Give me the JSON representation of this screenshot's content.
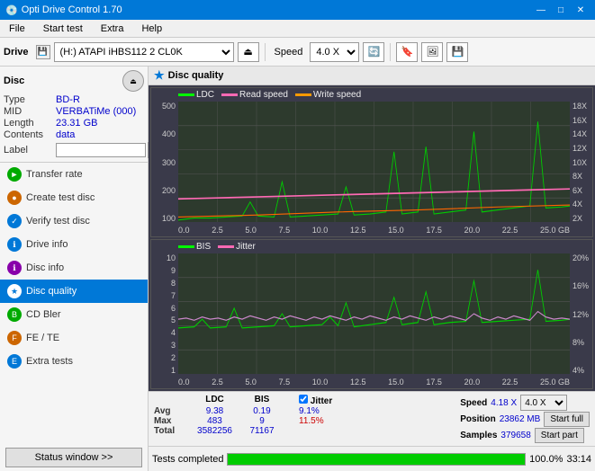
{
  "app": {
    "title": "Opti Drive Control 1.70",
    "icon": "💿"
  },
  "titlebar": {
    "title": "Opti Drive Control 1.70",
    "minimize": "—",
    "maximize": "□",
    "close": "✕"
  },
  "menubar": {
    "items": [
      "File",
      "Start test",
      "Extra",
      "Help"
    ]
  },
  "toolbar": {
    "drive_label": "Drive",
    "drive_value": "(H:)  ATAPI iHBS112  2 CL0K",
    "speed_label": "Speed",
    "speed_value": "4.0 X"
  },
  "disc": {
    "header": "Disc",
    "type_label": "Type",
    "type_value": "BD-R",
    "mid_label": "MID",
    "mid_value": "VERBATiMe (000)",
    "length_label": "Length",
    "length_value": "23.31 GB",
    "contents_label": "Contents",
    "contents_value": "data",
    "label_label": "Label",
    "label_placeholder": ""
  },
  "sidebar_items": [
    {
      "id": "transfer-rate",
      "label": "Transfer rate",
      "icon": "►",
      "active": false
    },
    {
      "id": "create-test-disc",
      "label": "Create test disc",
      "icon": "●",
      "active": false
    },
    {
      "id": "verify-test-disc",
      "label": "Verify test disc",
      "icon": "✓",
      "active": false
    },
    {
      "id": "drive-info",
      "label": "Drive info",
      "icon": "ℹ",
      "active": false
    },
    {
      "id": "disc-info",
      "label": "Disc info",
      "icon": "ℹ",
      "active": false
    },
    {
      "id": "disc-quality",
      "label": "Disc quality",
      "icon": "★",
      "active": true
    },
    {
      "id": "cd-bler",
      "label": "CD Bler",
      "icon": "B",
      "active": false
    },
    {
      "id": "fe-te",
      "label": "FE / TE",
      "icon": "F",
      "active": false
    },
    {
      "id": "extra-tests",
      "label": "Extra tests",
      "icon": "E",
      "active": false
    }
  ],
  "status_window_btn": "Status window >>",
  "content_title": "Disc quality",
  "chart1": {
    "legend": [
      {
        "label": "LDC",
        "color": "#00ff00"
      },
      {
        "label": "Read speed",
        "color": "#ff69b4"
      },
      {
        "label": "Write speed",
        "color": "#ff9900"
      }
    ],
    "y_left": [
      "500",
      "400",
      "300",
      "200",
      "100"
    ],
    "y_right": [
      "18X",
      "16X",
      "14X",
      "12X",
      "10X",
      "8X",
      "6X",
      "4X",
      "2X"
    ],
    "x_labels": [
      "0.0",
      "2.5",
      "5.0",
      "7.5",
      "10.0",
      "12.5",
      "15.0",
      "17.5",
      "20.0",
      "22.5",
      "25.0 GB"
    ]
  },
  "chart2": {
    "legend": [
      {
        "label": "BIS",
        "color": "#00ff00"
      },
      {
        "label": "Jitter",
        "color": "#ff69b4"
      }
    ],
    "y_left": [
      "10",
      "9",
      "8",
      "7",
      "6",
      "5",
      "4",
      "3",
      "2",
      "1"
    ],
    "y_right": [
      "20%",
      "16%",
      "12%",
      "8%",
      "4%"
    ],
    "x_labels": [
      "0.0",
      "2.5",
      "5.0",
      "7.5",
      "10.0",
      "12.5",
      "15.0",
      "17.5",
      "20.0",
      "22.5",
      "25.0 GB"
    ]
  },
  "stats": {
    "ldc_label": "LDC",
    "bis_label": "BIS",
    "jitter_label": "Jitter",
    "speed_label": "Speed",
    "avg_label": "Avg",
    "max_label": "Max",
    "total_label": "Total",
    "ldc_avg": "9.38",
    "ldc_max": "483",
    "ldc_total": "3582256",
    "bis_avg": "0.19",
    "bis_max": "9",
    "bis_total": "71167",
    "jitter_avg": "9.1%",
    "jitter_max": "11.5%",
    "speed_value": "4.18 X",
    "speed_select": "4.0 X",
    "position_label": "Position",
    "position_value": "23862 MB",
    "samples_label": "Samples",
    "samples_value": "379658",
    "start_full": "Start full",
    "start_part": "Start part"
  },
  "statusbar": {
    "status_text": "Tests completed",
    "progress": 100,
    "time": "33:14"
  }
}
